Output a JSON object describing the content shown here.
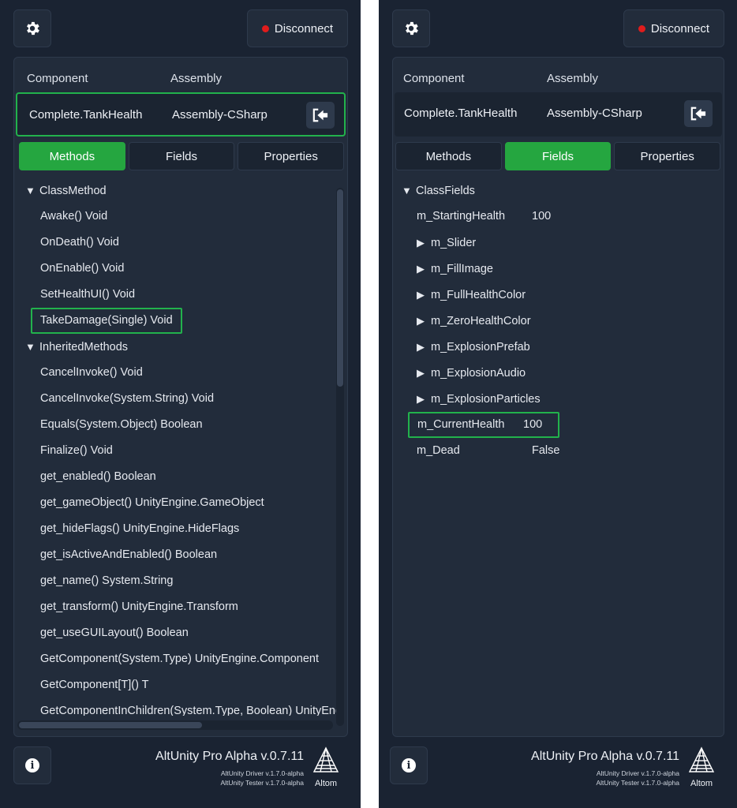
{
  "header": {
    "disconnect_label": "Disconnect"
  },
  "columns": {
    "component": "Component",
    "assembly": "Assembly"
  },
  "component_row": {
    "component": "Complete.TankHealth",
    "assembly": "Assembly-CSharp"
  },
  "tabs": [
    "Methods",
    "Fields",
    "Properties"
  ],
  "methods": {
    "group1": "ClassMethod",
    "class_methods": [
      "Awake() Void",
      "OnDeath() Void",
      "OnEnable() Void",
      "SetHealthUI() Void",
      "TakeDamage(Single) Void"
    ],
    "group2": "InheritedMethods",
    "inherited_methods": [
      "CancelInvoke() Void",
      "CancelInvoke(System.String) Void",
      "Equals(System.Object) Boolean",
      "Finalize() Void",
      "get_enabled() Boolean",
      "get_gameObject() UnityEngine.GameObject",
      "get_hideFlags() UnityEngine.HideFlags",
      "get_isActiveAndEnabled() Boolean",
      "get_name() System.String",
      "get_transform() UnityEngine.Transform",
      "get_useGUILayout() Boolean",
      "GetComponent(System.Type) UnityEngine.Component",
      "GetComponent[T]() T",
      "GetComponentInChildren(System.Type, Boolean) UnityEngine.Component"
    ]
  },
  "fields": {
    "group": "ClassFields",
    "starting_health": {
      "name": "m_StartingHealth",
      "value": "100"
    },
    "expandable": [
      "m_Slider",
      "m_FillImage",
      "m_FullHealthColor",
      "m_ZeroHealthColor",
      "m_ExplosionPrefab",
      "m_ExplosionAudio",
      "m_ExplosionParticles"
    ],
    "current_health": {
      "name": "m_CurrentHealth",
      "value": "100"
    },
    "dead": {
      "name": "m_Dead",
      "value": "False"
    }
  },
  "footer": {
    "version": "AltUnity Pro Alpha v.0.7.11",
    "driver": "AltUnity Driver v.1.7.0-alpha",
    "tester": "AltUnity Tester v.1.7.0-alpha",
    "logo_text": "Altom"
  },
  "colors": {
    "background": "#1a2332",
    "panel": "#222c3b",
    "accent_green": "#25a640",
    "highlight_green": "#22b24c",
    "status_red": "#e01c1c"
  }
}
